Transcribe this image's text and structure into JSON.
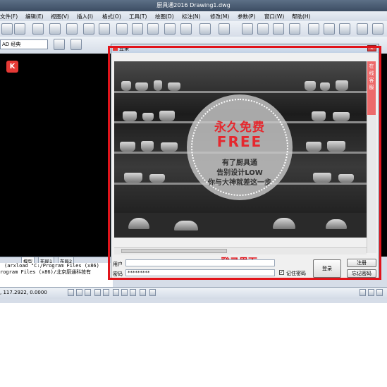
{
  "window": {
    "title": "厨具通2016    Drawing1.dwg"
  },
  "menu": [
    "文件(F)",
    "编辑(E)",
    "视图(V)",
    "插入(I)",
    "格式(O)",
    "工具(T)",
    "绘图(D)",
    "标注(N)",
    "修改(M)",
    "参数(P)",
    "窗口(W)",
    "帮助(H)"
  ],
  "toolbar2": {
    "workspace": "AD 经典"
  },
  "canvas": {
    "logo_letter": "K"
  },
  "layout_tabs": [
    "模型",
    "布局1",
    "布局2"
  ],
  "command_lines": [
    "(arxload \"C:/Program Files (x86)",
    "rogram Files (x86)/北京厨通科技有"
  ],
  "status": {
    "coords": ", 117.2922, 0.0000"
  },
  "dialog": {
    "title": "登录",
    "close": "x",
    "ad": {
      "headline": "永久免费",
      "headline2": "FREE",
      "line1": "有了厨具通",
      "line2": "告别设计LOW",
      "line3": "你与大神就差这一步"
    },
    "side_tab": "在线客服",
    "caption": "登录界面",
    "user_label": "用户",
    "user_value": "",
    "password_label": "密码",
    "password_value": "*********",
    "remember_label": "记住密码",
    "remember_checked": "✓",
    "login_button": "登录",
    "register_button": "注册",
    "forgot_button": "忘记密码"
  },
  "colors": {
    "accent_red": "#e1141b",
    "circle_red": "#e5282e"
  }
}
